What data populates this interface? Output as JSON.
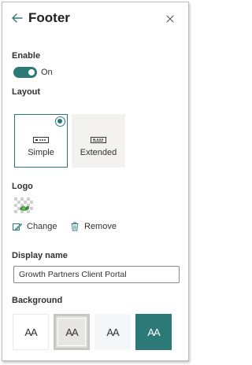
{
  "header": {
    "title": "Footer",
    "back_icon": "arrow-left-icon",
    "close_icon": "close-icon"
  },
  "enable": {
    "label": "Enable",
    "state_text": "On",
    "is_on": true
  },
  "layout": {
    "label": "Layout",
    "options": [
      {
        "label": "Simple",
        "selected": true,
        "icon": "simple-layout-icon"
      },
      {
        "label": "Extended",
        "selected": false,
        "icon": "extended-layout-icon"
      }
    ]
  },
  "logo": {
    "label": "Logo",
    "change_label": "Change",
    "remove_label": "Remove",
    "change_icon": "edit-image-icon",
    "remove_icon": "trash-icon"
  },
  "display_name": {
    "label": "Display name",
    "value": "Growth Partners Client Portal"
  },
  "background": {
    "label": "Background",
    "options": [
      {
        "text": "AA",
        "bg": "#ffffff",
        "fg": "#323130",
        "selected": false
      },
      {
        "text": "AA",
        "bg": "#e1dfdd",
        "fg": "#323130",
        "selected": true
      },
      {
        "text": "AA",
        "bg": "#f4f7f7",
        "fg": "#323130",
        "selected": false
      },
      {
        "text": "AA",
        "bg": "#2b7a78",
        "fg": "#ffffff",
        "selected": false
      }
    ]
  },
  "colors": {
    "accent": "#2b7a78",
    "text": "#323130"
  }
}
